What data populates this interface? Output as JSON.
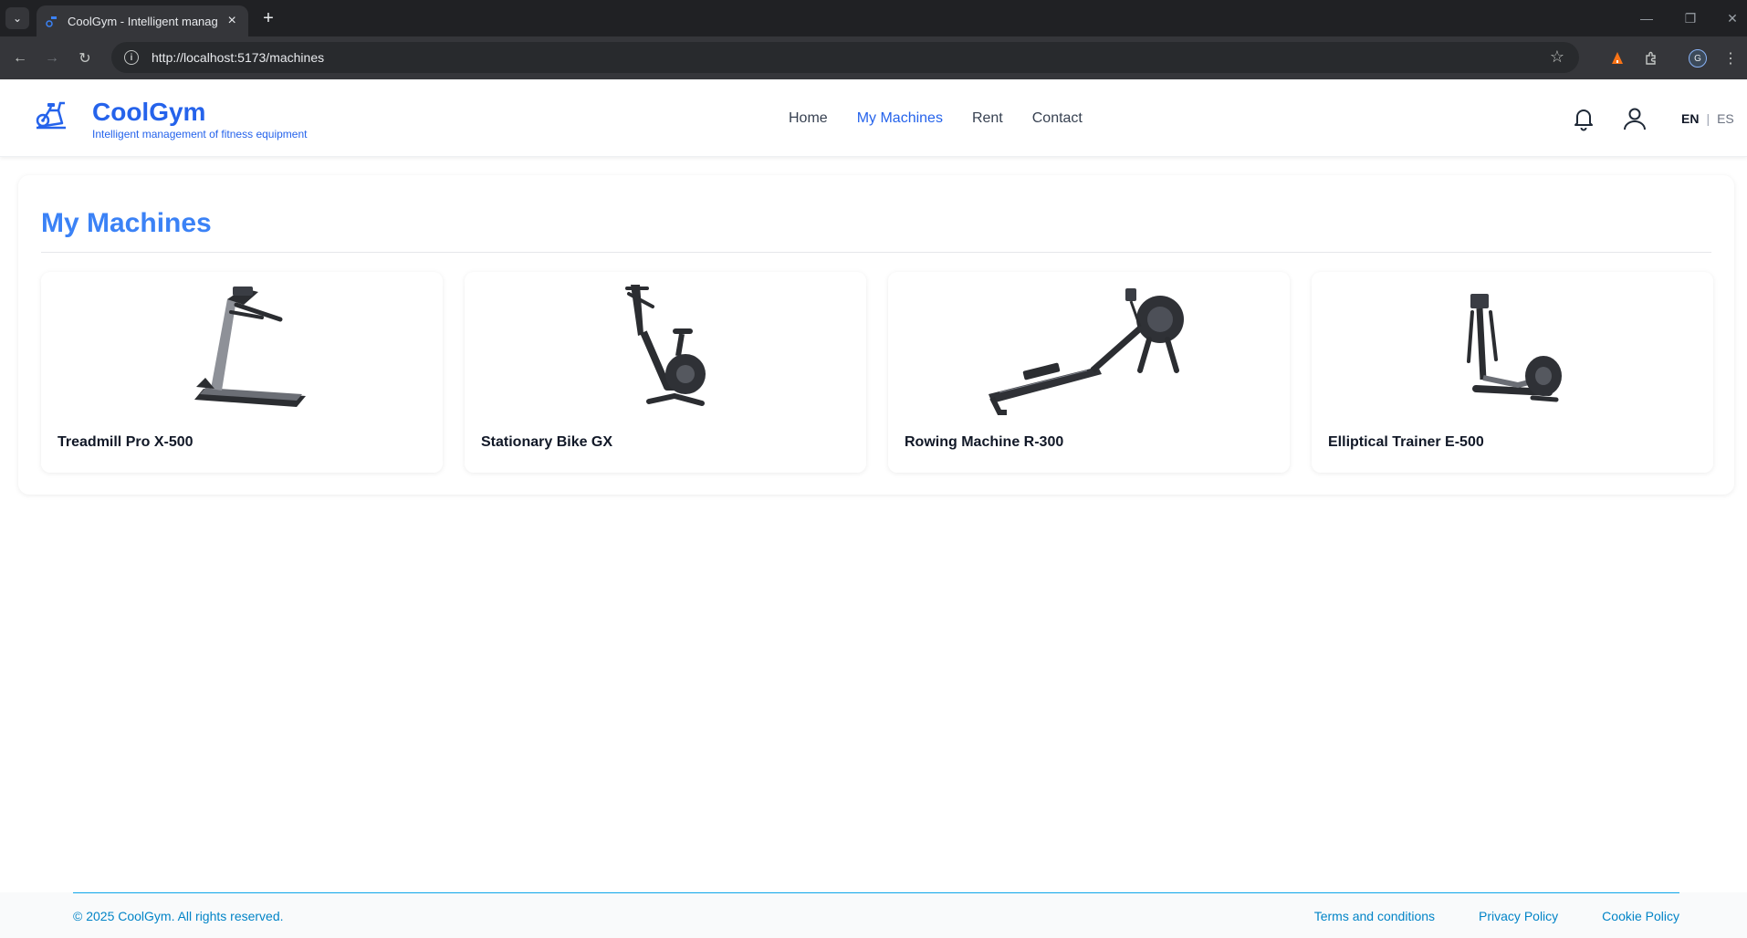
{
  "browser": {
    "tab_title": "CoolGym - Intelligent management of fitness equipment",
    "url": "http://localhost:5173/machines",
    "profile_initial": "G"
  },
  "header": {
    "brand_name": "CoolGym",
    "brand_tagline": "Intelligent management of fitness equipment",
    "nav": [
      "Home",
      "My Machines",
      "Rent",
      "Contact"
    ],
    "active_nav": "My Machines",
    "lang_en": "EN",
    "lang_sep": "|",
    "lang_es": "ES"
  },
  "main": {
    "title": "My Machines",
    "machines": [
      {
        "name": "Treadmill Pro X-500",
        "icon": "treadmill-icon"
      },
      {
        "name": "Stationary Bike GX",
        "icon": "stationary-bike-icon"
      },
      {
        "name": "Rowing Machine R-300",
        "icon": "rowing-machine-icon"
      },
      {
        "name": "Elliptical Trainer E-500",
        "icon": "elliptical-trainer-icon"
      }
    ]
  },
  "footer": {
    "copyright": "© 2025 CoolGym. All rights reserved.",
    "links": [
      "Terms and conditions",
      "Privacy Policy",
      "Cookie Policy"
    ]
  },
  "colors": {
    "brand": "#2563eb",
    "title": "#3b82f6",
    "footer_link": "#0284c7"
  }
}
